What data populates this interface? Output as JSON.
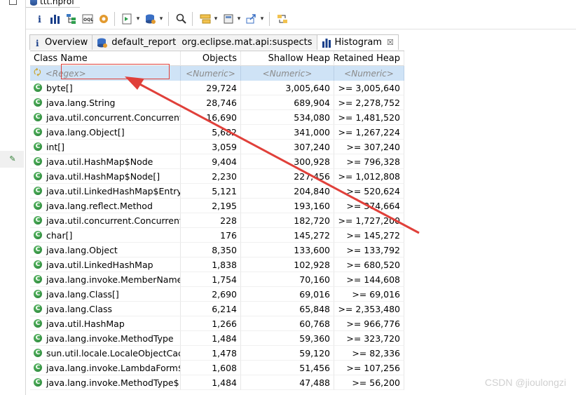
{
  "file_tab": {
    "label": "ttt.hprof"
  },
  "toolbar": {
    "buttons": [
      "info-icon",
      "histogram-icon",
      "dominator-tree-icon",
      "oql-icon",
      "gear-settings-icon",
      "run-report-icon",
      "heap-dump-icon",
      "search-icon",
      "group-icon",
      "calculator-icon",
      "export-icon",
      "compare-icon"
    ]
  },
  "tabs": [
    {
      "label": "Overview",
      "icon": "info-icon"
    },
    {
      "label": "default_report  org.eclipse.mat.api:suspects",
      "icon": "report-icon"
    },
    {
      "label": "Histogram",
      "icon": "histogram-icon",
      "close": "☒"
    }
  ],
  "columns": [
    "Class Name",
    "Objects",
    "Shallow Heap",
    "Retained Heap"
  ],
  "filter": {
    "name": "<Regex>",
    "objects": "<Numeric>",
    "shallow": "<Numeric>",
    "retained": "<Numeric>"
  },
  "rows": [
    {
      "name": "byte[]",
      "objects": "29,724",
      "shallow": "3,005,640",
      "retained": ">= 3,005,640"
    },
    {
      "name": "java.lang.String",
      "objects": "28,746",
      "shallow": "689,904",
      "retained": ">= 2,278,752"
    },
    {
      "name": "java.util.concurrent.Concurrent...",
      "objects": "16,690",
      "shallow": "534,080",
      "retained": ">= 1,481,520"
    },
    {
      "name": "java.lang.Object[]",
      "objects": "5,682",
      "shallow": "341,000",
      "retained": ">= 1,267,224"
    },
    {
      "name": "int[]",
      "objects": "3,059",
      "shallow": "307,240",
      "retained": ">= 307,240"
    },
    {
      "name": "java.util.HashMap$Node",
      "objects": "9,404",
      "shallow": "300,928",
      "retained": ">= 796,328"
    },
    {
      "name": "java.util.HashMap$Node[]",
      "objects": "2,230",
      "shallow": "227,456",
      "retained": ">= 1,012,808"
    },
    {
      "name": "java.util.LinkedHashMap$Entry",
      "objects": "5,121",
      "shallow": "204,840",
      "retained": ">= 520,624"
    },
    {
      "name": "java.lang.reflect.Method",
      "objects": "2,195",
      "shallow": "193,160",
      "retained": ">= 374,664"
    },
    {
      "name": "java.util.concurrent.Concurrent...",
      "objects": "228",
      "shallow": "182,720",
      "retained": ">= 1,727,200"
    },
    {
      "name": "char[]",
      "objects": "176",
      "shallow": "145,272",
      "retained": ">= 145,272"
    },
    {
      "name": "java.lang.Object",
      "objects": "8,350",
      "shallow": "133,600",
      "retained": ">= 133,792"
    },
    {
      "name": "java.util.LinkedHashMap",
      "objects": "1,838",
      "shallow": "102,928",
      "retained": ">= 680,520"
    },
    {
      "name": "java.lang.invoke.MemberName",
      "objects": "1,754",
      "shallow": "70,160",
      "retained": ">= 144,608"
    },
    {
      "name": "java.lang.Class[]",
      "objects": "2,690",
      "shallow": "69,016",
      "retained": ">= 69,016"
    },
    {
      "name": "java.lang.Class",
      "objects": "6,214",
      "shallow": "65,848",
      "retained": ">= 2,353,480"
    },
    {
      "name": "java.util.HashMap",
      "objects": "1,266",
      "shallow": "60,768",
      "retained": ">= 966,776"
    },
    {
      "name": "java.lang.invoke.MethodType",
      "objects": "1,484",
      "shallow": "59,360",
      "retained": ">= 323,720"
    },
    {
      "name": "sun.util.locale.LocaleObjectCac...",
      "objects": "1,478",
      "shallow": "59,120",
      "retained": ">= 82,336"
    },
    {
      "name": "java.lang.invoke.LambdaForm$...",
      "objects": "1,608",
      "shallow": "51,456",
      "retained": ">= 107,256"
    },
    {
      "name": "java.lang.invoke.MethodType$...",
      "objects": "1,484",
      "shallow": "47,488",
      "retained": ">= 56,200"
    }
  ],
  "watermark": "CSDN @jioulongzi",
  "colors": {
    "filter_row": "#cfe3f6",
    "annotation": "#e0403a",
    "class_icon": "#1f7a2e"
  }
}
